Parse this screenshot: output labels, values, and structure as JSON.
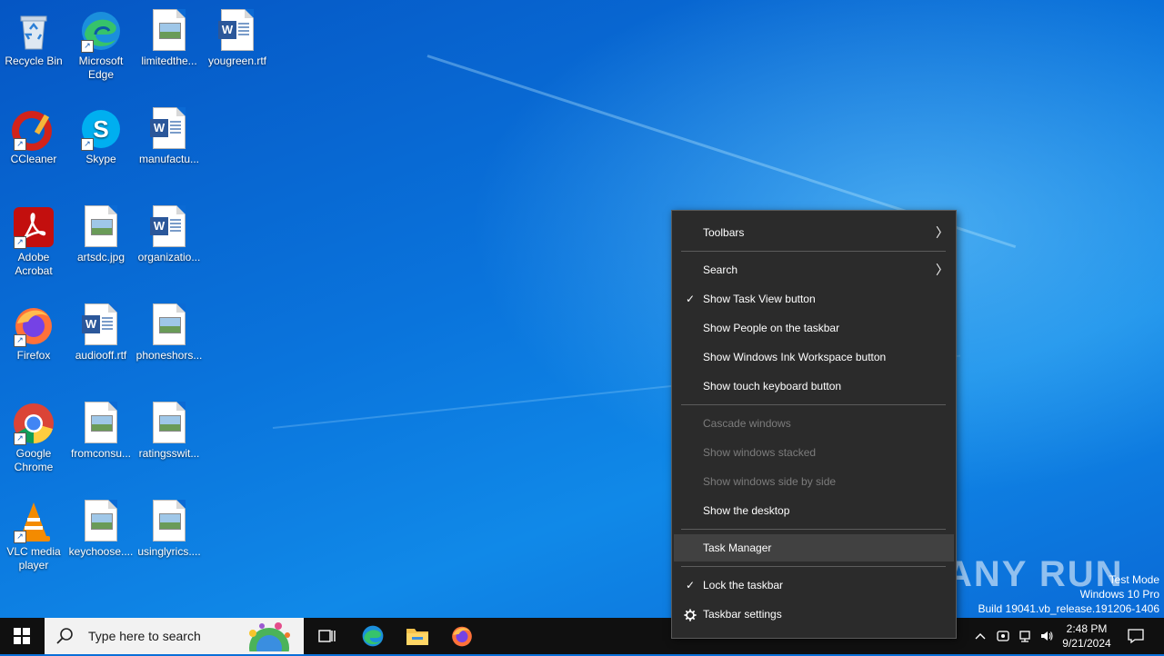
{
  "desktop_icons": [
    {
      "label": "Recycle Bin",
      "icon": "recycle-bin-icon"
    },
    {
      "label": "Microsoft Edge",
      "icon": "edge-icon"
    },
    {
      "label": "limitedthe...",
      "icon": "image-file-icon"
    },
    {
      "label": "yougreen.rtf",
      "icon": "word-doc-icon"
    },
    {
      "label": "CCleaner",
      "icon": "ccleaner-icon"
    },
    {
      "label": "Skype",
      "icon": "skype-icon"
    },
    {
      "label": "manufactu...",
      "icon": "word-doc-icon"
    },
    {
      "label": "Adobe Acrobat",
      "icon": "acrobat-icon"
    },
    {
      "label": "artsdc.jpg",
      "icon": "image-file-icon"
    },
    {
      "label": "organizatio...",
      "icon": "word-doc-icon"
    },
    {
      "label": "Firefox",
      "icon": "firefox-icon"
    },
    {
      "label": "audiooff.rtf",
      "icon": "word-doc-icon"
    },
    {
      "label": "phoneshors...",
      "icon": "image-file-icon"
    },
    {
      "label": "Google Chrome",
      "icon": "chrome-icon"
    },
    {
      "label": "fromconsu...",
      "icon": "image-file-icon"
    },
    {
      "label": "ratingsswit...",
      "icon": "image-file-icon"
    },
    {
      "label": "VLC media player",
      "icon": "vlc-icon"
    },
    {
      "label": "keychoose....",
      "icon": "image-file-icon"
    },
    {
      "label": "usinglyrics....",
      "icon": "image-file-icon"
    }
  ],
  "context_menu": {
    "items": [
      {
        "label": "Toolbars",
        "submenu": true
      },
      {
        "label": "Search",
        "submenu": true
      },
      {
        "label": "Show Task View button",
        "checked": true
      },
      {
        "label": "Show People on the taskbar"
      },
      {
        "label": "Show Windows Ink Workspace button"
      },
      {
        "label": "Show touch keyboard button"
      },
      {
        "label": "Cascade windows",
        "disabled": true
      },
      {
        "label": "Show windows stacked",
        "disabled": true
      },
      {
        "label": "Show windows side by side",
        "disabled": true
      },
      {
        "label": "Show the desktop"
      },
      {
        "label": "Task Manager",
        "highlighted": true
      },
      {
        "label": "Lock the taskbar",
        "checked": true
      },
      {
        "label": "Taskbar settings",
        "icon": "gear-icon"
      }
    ],
    "check_glyph": "✓",
    "arrow_glyph": "〉"
  },
  "watermark": {
    "text": "ANY RUN"
  },
  "system_info": {
    "line1": "Test Mode",
    "line2": "Windows 10 Pro",
    "line3": "Build 19041.vb_release.191206-1406"
  },
  "taskbar": {
    "search_placeholder": "Type here to search",
    "pinned": [
      "task-view-icon",
      "edge-icon",
      "file-explorer-icon",
      "firefox-icon"
    ],
    "clock_time": "2:48 PM",
    "clock_date": "9/21/2024"
  },
  "colors": {
    "menu_bg": "#2b2b2b",
    "menu_highlight": "#414141",
    "taskbar_bg": "#101010",
    "desktop_blue": "#0a74dc"
  }
}
